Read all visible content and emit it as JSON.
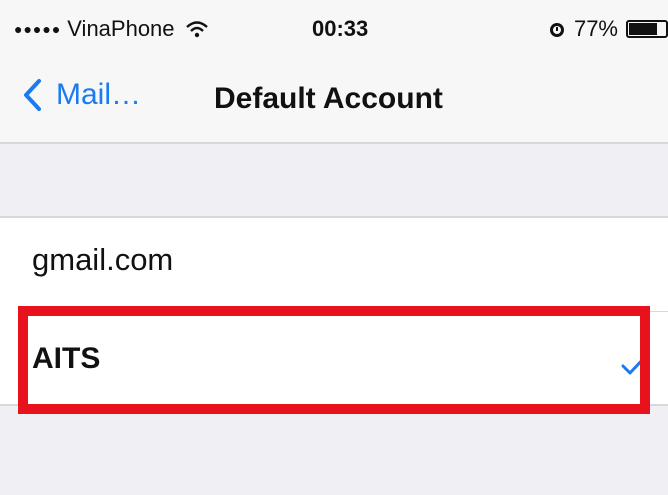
{
  "status_bar": {
    "signal_dots": "●●●●●",
    "carrier": "VinaPhone",
    "wifi_icon": "wifi-icon",
    "time": "00:33",
    "alarm_icon": "alarm-icon",
    "battery_percent": "77%",
    "battery_level": 0.77
  },
  "navbar": {
    "back_label": "Mail…",
    "title": "Default Account"
  },
  "accounts": [
    {
      "label": "gmail.com",
      "selected": false
    },
    {
      "label": "AITS",
      "selected": true
    }
  ],
  "colors": {
    "accent": "#1a7bf0",
    "highlight_box": "#e8121d",
    "background": "#efeff4"
  }
}
